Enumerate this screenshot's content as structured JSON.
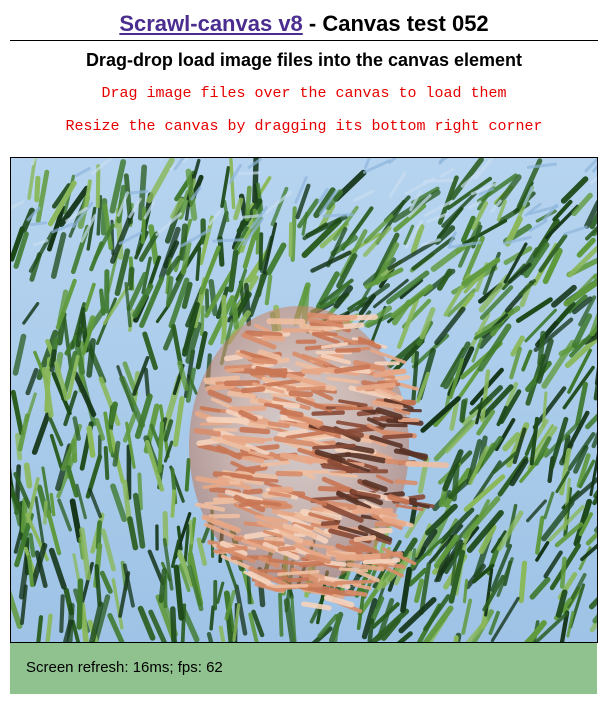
{
  "header": {
    "link_text": "Scrawl-canvas v8",
    "title_rest": " - Canvas test 052"
  },
  "subtitle": "Drag-drop load image files into the canvas element",
  "instructions": [
    "Drag image files over the canvas to load them",
    "Resize the canvas by dragging its bottom right corner"
  ],
  "canvas": {
    "image_description_icon": "painted-portrait",
    "colors": {
      "sky": "#a9cbeb",
      "foliage_dark": "#1e4a1a",
      "foliage_mid": "#3f7a2e",
      "foliage_light": "#8ab85a",
      "skin": "#e8a887",
      "skin_light": "#f6d3bd"
    }
  },
  "status": {
    "text": "Screen refresh: 16ms; fps: 62"
  },
  "colors": {
    "link": "#4a2d8f",
    "instruction": "#e60000",
    "status_bg": "#8fc28f"
  }
}
